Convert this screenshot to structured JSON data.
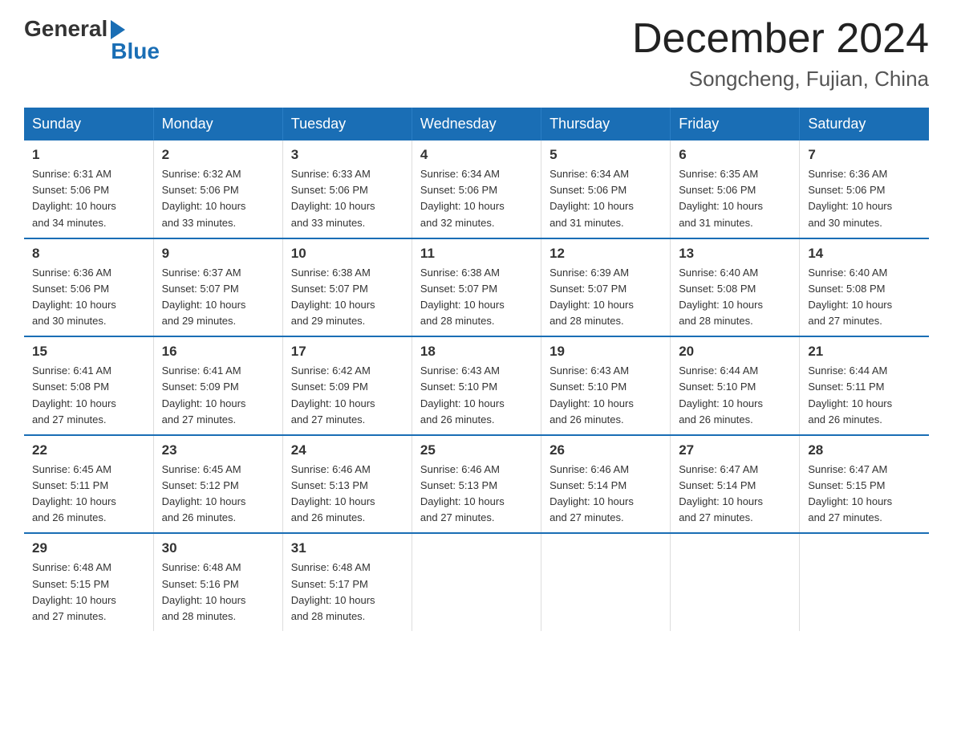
{
  "header": {
    "logo_general": "General",
    "logo_blue": "Blue",
    "month_title": "December 2024",
    "location": "Songcheng, Fujian, China"
  },
  "weekdays": [
    "Sunday",
    "Monday",
    "Tuesday",
    "Wednesday",
    "Thursday",
    "Friday",
    "Saturday"
  ],
  "weeks": [
    [
      {
        "day": "1",
        "sunrise": "6:31 AM",
        "sunset": "5:06 PM",
        "daylight": "10 hours and 34 minutes."
      },
      {
        "day": "2",
        "sunrise": "6:32 AM",
        "sunset": "5:06 PM",
        "daylight": "10 hours and 33 minutes."
      },
      {
        "day": "3",
        "sunrise": "6:33 AM",
        "sunset": "5:06 PM",
        "daylight": "10 hours and 33 minutes."
      },
      {
        "day": "4",
        "sunrise": "6:34 AM",
        "sunset": "5:06 PM",
        "daylight": "10 hours and 32 minutes."
      },
      {
        "day": "5",
        "sunrise": "6:34 AM",
        "sunset": "5:06 PM",
        "daylight": "10 hours and 31 minutes."
      },
      {
        "day": "6",
        "sunrise": "6:35 AM",
        "sunset": "5:06 PM",
        "daylight": "10 hours and 31 minutes."
      },
      {
        "day": "7",
        "sunrise": "6:36 AM",
        "sunset": "5:06 PM",
        "daylight": "10 hours and 30 minutes."
      }
    ],
    [
      {
        "day": "8",
        "sunrise": "6:36 AM",
        "sunset": "5:06 PM",
        "daylight": "10 hours and 30 minutes."
      },
      {
        "day": "9",
        "sunrise": "6:37 AM",
        "sunset": "5:07 PM",
        "daylight": "10 hours and 29 minutes."
      },
      {
        "day": "10",
        "sunrise": "6:38 AM",
        "sunset": "5:07 PM",
        "daylight": "10 hours and 29 minutes."
      },
      {
        "day": "11",
        "sunrise": "6:38 AM",
        "sunset": "5:07 PM",
        "daylight": "10 hours and 28 minutes."
      },
      {
        "day": "12",
        "sunrise": "6:39 AM",
        "sunset": "5:07 PM",
        "daylight": "10 hours and 28 minutes."
      },
      {
        "day": "13",
        "sunrise": "6:40 AM",
        "sunset": "5:08 PM",
        "daylight": "10 hours and 28 minutes."
      },
      {
        "day": "14",
        "sunrise": "6:40 AM",
        "sunset": "5:08 PM",
        "daylight": "10 hours and 27 minutes."
      }
    ],
    [
      {
        "day": "15",
        "sunrise": "6:41 AM",
        "sunset": "5:08 PM",
        "daylight": "10 hours and 27 minutes."
      },
      {
        "day": "16",
        "sunrise": "6:41 AM",
        "sunset": "5:09 PM",
        "daylight": "10 hours and 27 minutes."
      },
      {
        "day": "17",
        "sunrise": "6:42 AM",
        "sunset": "5:09 PM",
        "daylight": "10 hours and 27 minutes."
      },
      {
        "day": "18",
        "sunrise": "6:43 AM",
        "sunset": "5:10 PM",
        "daylight": "10 hours and 26 minutes."
      },
      {
        "day": "19",
        "sunrise": "6:43 AM",
        "sunset": "5:10 PM",
        "daylight": "10 hours and 26 minutes."
      },
      {
        "day": "20",
        "sunrise": "6:44 AM",
        "sunset": "5:10 PM",
        "daylight": "10 hours and 26 minutes."
      },
      {
        "day": "21",
        "sunrise": "6:44 AM",
        "sunset": "5:11 PM",
        "daylight": "10 hours and 26 minutes."
      }
    ],
    [
      {
        "day": "22",
        "sunrise": "6:45 AM",
        "sunset": "5:11 PM",
        "daylight": "10 hours and 26 minutes."
      },
      {
        "day": "23",
        "sunrise": "6:45 AM",
        "sunset": "5:12 PM",
        "daylight": "10 hours and 26 minutes."
      },
      {
        "day": "24",
        "sunrise": "6:46 AM",
        "sunset": "5:13 PM",
        "daylight": "10 hours and 26 minutes."
      },
      {
        "day": "25",
        "sunrise": "6:46 AM",
        "sunset": "5:13 PM",
        "daylight": "10 hours and 27 minutes."
      },
      {
        "day": "26",
        "sunrise": "6:46 AM",
        "sunset": "5:14 PM",
        "daylight": "10 hours and 27 minutes."
      },
      {
        "day": "27",
        "sunrise": "6:47 AM",
        "sunset": "5:14 PM",
        "daylight": "10 hours and 27 minutes."
      },
      {
        "day": "28",
        "sunrise": "6:47 AM",
        "sunset": "5:15 PM",
        "daylight": "10 hours and 27 minutes."
      }
    ],
    [
      {
        "day": "29",
        "sunrise": "6:48 AM",
        "sunset": "5:15 PM",
        "daylight": "10 hours and 27 minutes."
      },
      {
        "day": "30",
        "sunrise": "6:48 AM",
        "sunset": "5:16 PM",
        "daylight": "10 hours and 28 minutes."
      },
      {
        "day": "31",
        "sunrise": "6:48 AM",
        "sunset": "5:17 PM",
        "daylight": "10 hours and 28 minutes."
      },
      null,
      null,
      null,
      null
    ]
  ],
  "labels": {
    "sunrise": "Sunrise:",
    "sunset": "Sunset:",
    "daylight": "Daylight:"
  }
}
